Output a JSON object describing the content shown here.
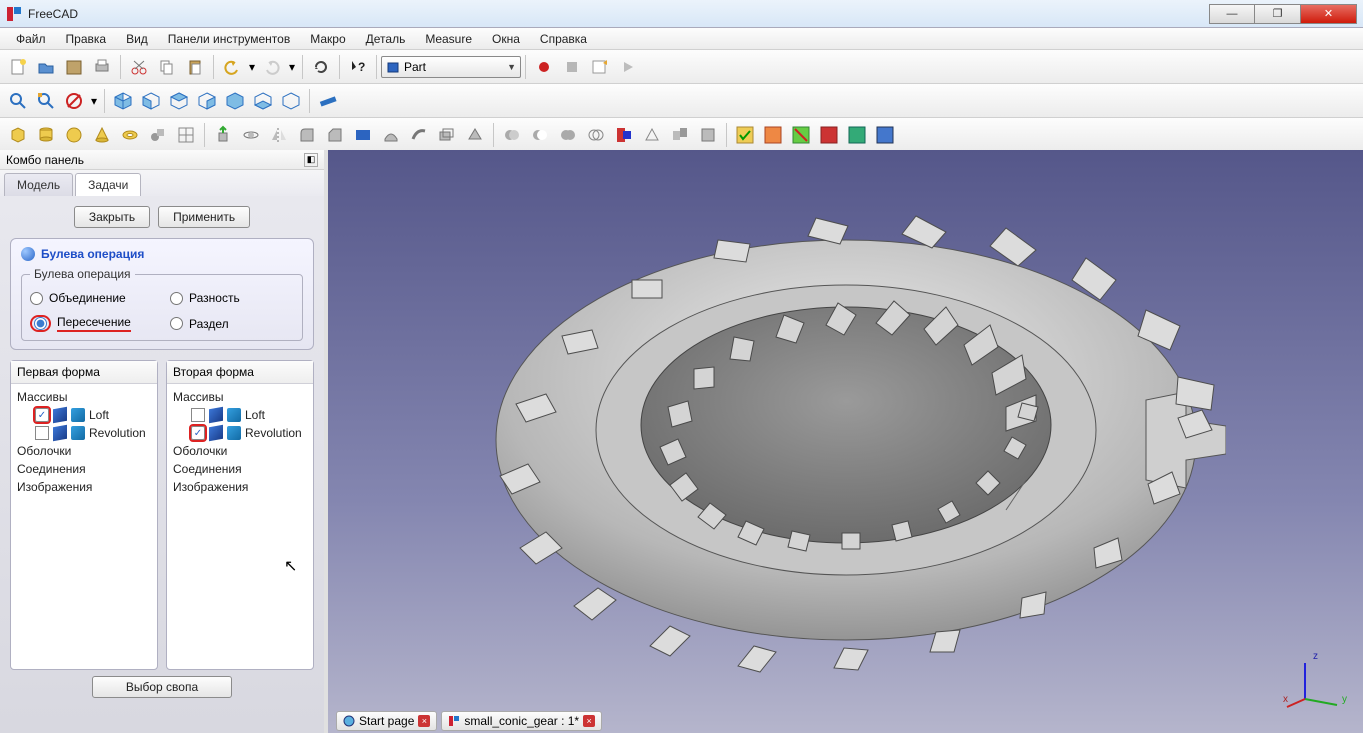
{
  "window": {
    "title": "FreeCAD"
  },
  "menu": [
    "Файл",
    "Правка",
    "Вид",
    "Панели инструментов",
    "Макро",
    "Деталь",
    "Measure",
    "Окна",
    "Справка"
  ],
  "workbench": {
    "selected": "Part"
  },
  "side": {
    "title": "Комбо панель",
    "tabs": {
      "model": "Модель",
      "tasks": "Задачи"
    },
    "buttons": {
      "close": "Закрыть",
      "apply": "Применить"
    },
    "panel_title": "Булева операция",
    "fieldset_legend": "Булева операция",
    "ops": {
      "union": "Объединение",
      "difference": "Разность",
      "intersection": "Пересечение",
      "section": "Раздел"
    },
    "shapeA": {
      "header": "Первая форма",
      "cat1": "Массивы",
      "items": [
        {
          "label": "Loft",
          "checked": true,
          "hl": true
        },
        {
          "label": "Revolution",
          "checked": false,
          "hl": false
        }
      ],
      "cat2": "Оболочки",
      "cat3": "Соединения",
      "cat4": "Изображения"
    },
    "shapeB": {
      "header": "Вторая форма",
      "cat1": "Массивы",
      "items": [
        {
          "label": "Loft",
          "checked": false,
          "hl": false
        },
        {
          "label": "Revolution",
          "checked": true,
          "hl": true
        }
      ],
      "cat2": "Оболочки",
      "cat3": "Соединения",
      "cat4": "Изображения"
    },
    "swap": "Выбор свопа"
  },
  "doc_tabs": [
    {
      "label": "Start page",
      "icon": "globe"
    },
    {
      "label": "small_conic_gear : 1*",
      "icon": "freecad"
    }
  ],
  "axis": {
    "x": "x",
    "y": "y",
    "z": "z"
  }
}
